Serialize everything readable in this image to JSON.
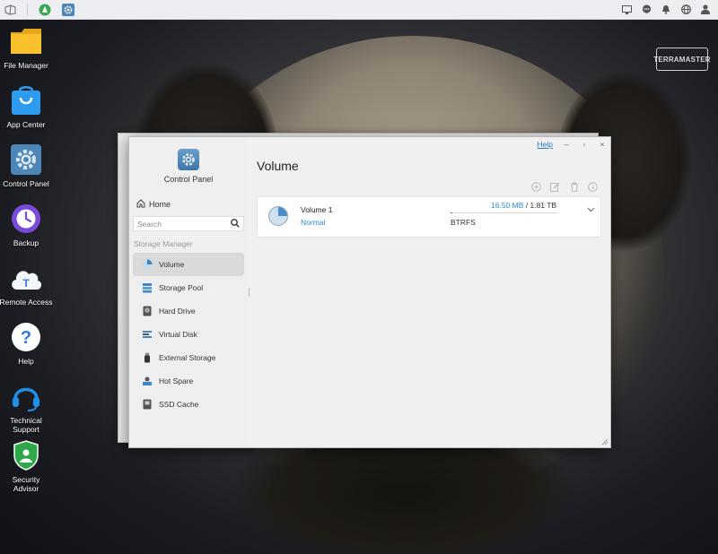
{
  "taskbar": {
    "left_icons": [
      "desktop-icon",
      "app-center-running-icon",
      "control-panel-running-icon"
    ],
    "right_icons": [
      "monitor-icon",
      "chat-icon",
      "bell-icon",
      "globe-icon",
      "user-icon"
    ]
  },
  "desktop": {
    "apps": [
      {
        "label": "File Manager",
        "icon": "folder-icon"
      },
      {
        "label": "App Center",
        "icon": "shopping-bag-icon"
      },
      {
        "label": "Control Panel",
        "icon": "gear-icon"
      },
      {
        "label": "Backup",
        "icon": "clock-icon"
      },
      {
        "label": "Remote Access",
        "icon": "cloud-icon"
      },
      {
        "label": "Help",
        "icon": "question-icon"
      },
      {
        "label": "Technical Support",
        "label_line1": "Technical",
        "label_line2": "Support",
        "icon": "headset-icon"
      },
      {
        "label": "Security Advisor",
        "label_line1": "Security",
        "label_line2": "Advisor",
        "icon": "shield-icon"
      }
    ],
    "brand_logo": "TERRAMASTER"
  },
  "window": {
    "title": "Control Panel",
    "help_label": "Help",
    "controls": {
      "minimize": "–",
      "maximize": "▫",
      "close": "×"
    },
    "sidebar": {
      "home_label": "Home",
      "search_placeholder": "Search",
      "group_label": "Storage Manager",
      "items": [
        {
          "label": "Volume",
          "icon": "pie-icon",
          "active": true
        },
        {
          "label": "Storage Pool",
          "icon": "stack-icon"
        },
        {
          "label": "Hard Drive",
          "icon": "hard-drive-icon"
        },
        {
          "label": "Virtual Disk",
          "icon": "virtual-disk-icon"
        },
        {
          "label": "External Storage",
          "icon": "usb-icon"
        },
        {
          "label": "Hot Spare",
          "icon": "hot-spare-icon"
        },
        {
          "label": "SSD Cache",
          "icon": "ssd-icon"
        }
      ]
    },
    "main": {
      "title": "Volume",
      "toolbar": [
        "add-icon",
        "edit-icon",
        "delete-icon",
        "info-icon"
      ],
      "volume": {
        "name": "Volume 1",
        "status": "Normal",
        "used": "16.50 MB",
        "separator": " / ",
        "total": "1.81 TB",
        "filesystem": "BTRFS",
        "usage_fraction": 0.01
      }
    }
  },
  "colors": {
    "accent": "#2a8bd0",
    "active_nav": "#d9d9d9"
  }
}
